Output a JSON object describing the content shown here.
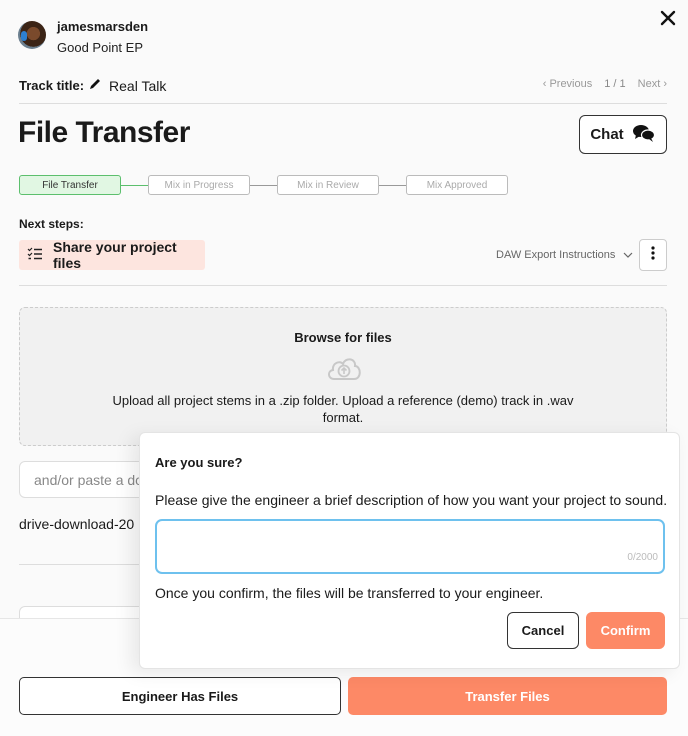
{
  "header": {
    "username": "jamesmarsden",
    "project": "Good Point EP",
    "close_icon": "close-icon"
  },
  "track": {
    "label": "Track title:",
    "edit_icon": "pencil-icon",
    "name": "Real Talk"
  },
  "pager": {
    "previous": "Previous",
    "count": "1 / 1",
    "next": "Next"
  },
  "page": {
    "title": "File Transfer",
    "chat_label": "Chat",
    "chat_icon": "chat-bubbles-icon"
  },
  "steps": [
    {
      "label": "File Transfer",
      "active": true
    },
    {
      "label": "Mix in Progress",
      "active": false
    },
    {
      "label": "Mix in Review",
      "active": false
    },
    {
      "label": "Mix Approved",
      "active": false
    }
  ],
  "next_steps": {
    "label": "Next steps:",
    "item": "Share your project files",
    "item_icon": "checklist-icon",
    "daw_dropdown": "DAW Export Instructions"
  },
  "upload": {
    "title": "Browse for files",
    "icon": "cloud-upload-icon",
    "description": "Upload all project stems in a .zip folder. Upload a reference (demo) track in .wav format."
  },
  "link_input": {
    "placeholder": "and/or paste a dc"
  },
  "file": {
    "name": "drive-download-20"
  },
  "modal": {
    "title": "Are you sure?",
    "prompt": "Please give the engineer a brief description of how you want your project to sound.",
    "textarea_value": "",
    "counter": "0/2000",
    "note": "Once you confirm, the files will be transferred to your engineer.",
    "cancel": "Cancel",
    "confirm": "Confirm"
  },
  "footer": {
    "engineer_has_files": "Engineer Has Files",
    "transfer_files": "Transfer Files"
  },
  "colors": {
    "accent": "#fd8966",
    "active_step_bg": "#e1f7e3",
    "active_step_border": "#5cbf6d",
    "next_step_bg": "#fde5df",
    "focus_border": "#6ec1ee"
  }
}
